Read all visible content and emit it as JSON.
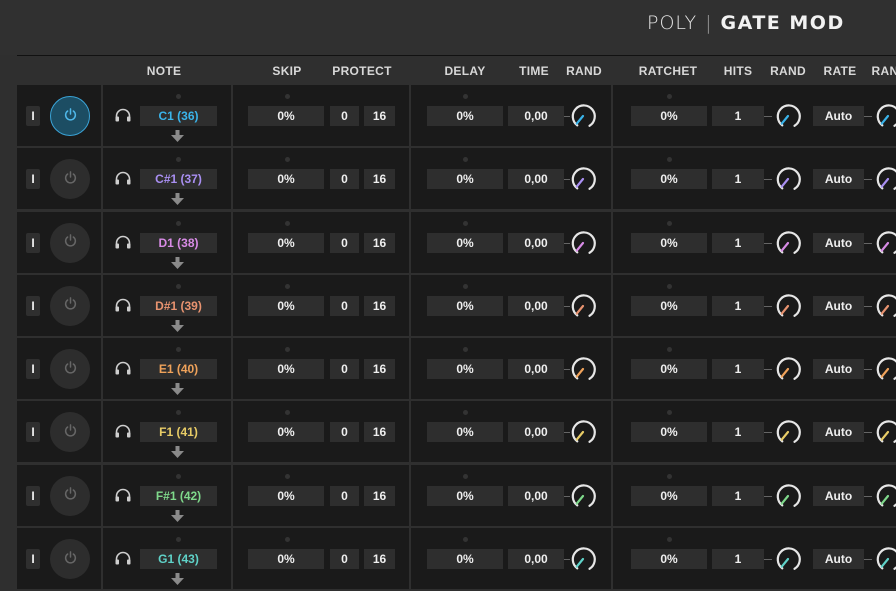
{
  "header": {
    "brand_poly": "POLY",
    "brand_sep": "|",
    "brand_mode": "GATE MOD"
  },
  "columns": {
    "note": "NOTE",
    "skip": "SKIP",
    "protect": "PROTECT",
    "delay": "DELAY",
    "time": "TIME",
    "rand1": "RAND",
    "ratchet": "RATCHET",
    "hits": "HITS",
    "rand2": "RAND",
    "rate": "RATE",
    "rand3": "RAN"
  },
  "rows": [
    {
      "lane": "I",
      "power_on": true,
      "note": "C1 (36)",
      "color": "#3ab4ea",
      "skip": "0%",
      "protect_min": "0",
      "protect_max": "16",
      "delay": "0%",
      "time": "0,00",
      "ratchet": "0%",
      "hits": "1",
      "rate": "Auto"
    },
    {
      "lane": "I",
      "power_on": false,
      "note": "C#1 (37)",
      "color": "#a98ff2",
      "skip": "0%",
      "protect_min": "0",
      "protect_max": "16",
      "delay": "0%",
      "time": "0,00",
      "ratchet": "0%",
      "hits": "1",
      "rate": "Auto"
    },
    {
      "lane": "I",
      "power_on": false,
      "note": "D1 (38)",
      "color": "#d88be6",
      "skip": "0%",
      "protect_min": "0",
      "protect_max": "16",
      "delay": "0%",
      "time": "0,00",
      "ratchet": "0%",
      "hits": "1",
      "rate": "Auto"
    },
    {
      "lane": "I",
      "power_on": false,
      "note": "D#1 (39)",
      "color": "#e89370",
      "skip": "0%",
      "protect_min": "0",
      "protect_max": "16",
      "delay": "0%",
      "time": "0,00",
      "ratchet": "0%",
      "hits": "1",
      "rate": "Auto"
    },
    {
      "lane": "I",
      "power_on": false,
      "note": "E1 (40)",
      "color": "#efa25a",
      "skip": "0%",
      "protect_min": "0",
      "protect_max": "16",
      "delay": "0%",
      "time": "0,00",
      "ratchet": "0%",
      "hits": "1",
      "rate": "Auto"
    },
    {
      "lane": "I",
      "power_on": false,
      "note": "F1 (41)",
      "color": "#e8cc66",
      "skip": "0%",
      "protect_min": "0",
      "protect_max": "16",
      "delay": "0%",
      "time": "0,00",
      "ratchet": "0%",
      "hits": "1",
      "rate": "Auto"
    },
    {
      "lane": "I",
      "power_on": false,
      "note": "F#1 (42)",
      "color": "#7fd98b",
      "skip": "0%",
      "protect_min": "0",
      "protect_max": "16",
      "delay": "0%",
      "time": "0,00",
      "ratchet": "0%",
      "hits": "1",
      "rate": "Auto"
    },
    {
      "lane": "I",
      "power_on": false,
      "note": "G1 (43)",
      "color": "#5fd2c8",
      "skip": "0%",
      "protect_min": "0",
      "protect_max": "16",
      "delay": "0%",
      "time": "0,00",
      "ratchet": "0%",
      "hits": "1",
      "rate": "Auto"
    }
  ],
  "icons": {
    "power": "power-icon",
    "headphones": "headphones-icon",
    "arrow": "arrow-down-icon",
    "knob": "knob-icon"
  },
  "theme": {
    "accent": "#3aa3d6",
    "panel": "#1a1a1a",
    "field": "#2e2e2e",
    "background": "#2f2f2f"
  }
}
